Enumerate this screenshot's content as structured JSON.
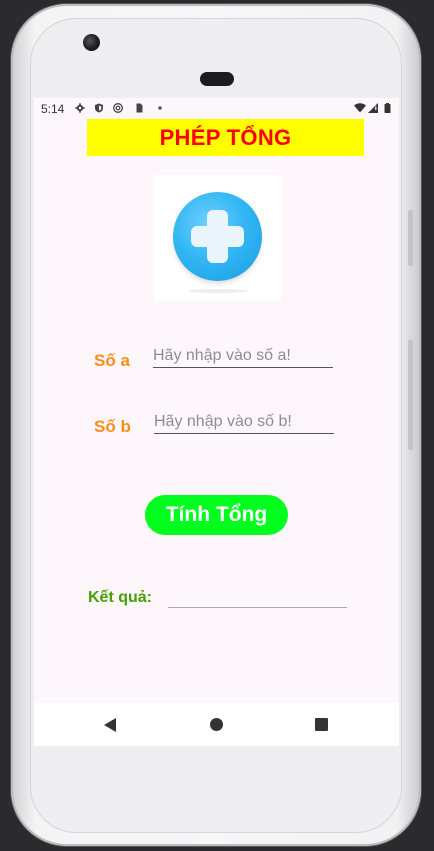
{
  "status_bar": {
    "time": "5:14",
    "left_icons": [
      "gear-icon",
      "shield-icon",
      "sync-icon",
      "sim-card-icon",
      "dot-icon"
    ],
    "right_icons": [
      "wifi-icon",
      "signal-icon",
      "battery-icon"
    ]
  },
  "header": {
    "title": "PHÉP TỔNG"
  },
  "inputs": {
    "a": {
      "label": "Số a",
      "placeholder": "Hãy nhập vào số a!"
    },
    "b": {
      "label": "Số b",
      "placeholder": "Hãy nhập vào số b!"
    }
  },
  "action": {
    "calculate_label": "Tính Tổng"
  },
  "result": {
    "label": "Kết quả:",
    "value": ""
  },
  "colors": {
    "title_bg": "#ffff00",
    "title_text": "#ff0000",
    "input_label": "#ff8c1a",
    "button_bg": "#00ff1e",
    "result_label": "#44a000"
  },
  "nav_bar": {
    "buttons": [
      "back-icon",
      "home-icon",
      "recents-icon"
    ]
  }
}
